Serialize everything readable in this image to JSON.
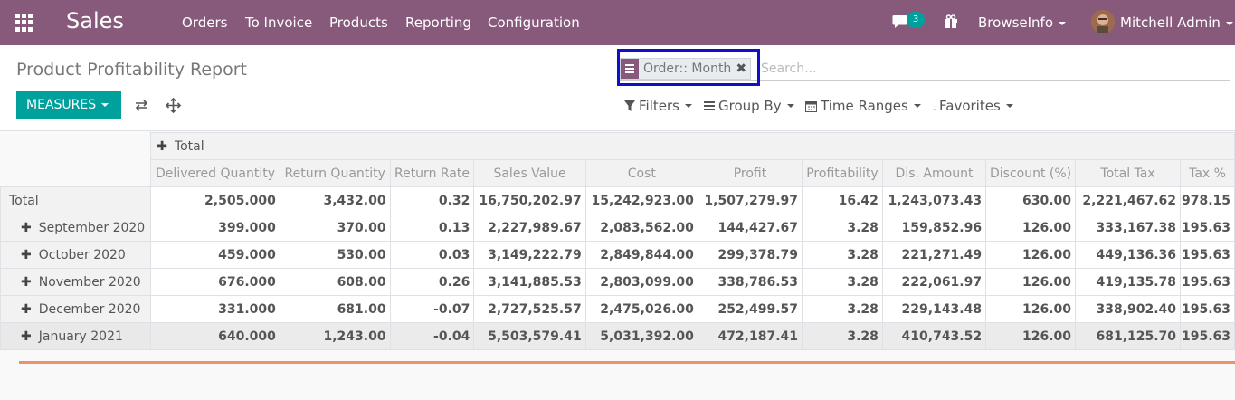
{
  "navbar": {
    "brand": "Sales",
    "menu": [
      "Orders",
      "To Invoice",
      "Products",
      "Reporting",
      "Configuration"
    ],
    "chat_count": "3",
    "browseinfo": "BrowseInfo",
    "user": "Mitchell Admin"
  },
  "control": {
    "title": "Product Profitability Report",
    "measures": "MEASURES",
    "facet": "Order:: Month",
    "search_placeholder": "Search...",
    "filters": "Filters",
    "group_by": "Group By",
    "time_ranges": "Time Ranges",
    "favorites": "Favorites"
  },
  "pivot": {
    "col_total": "Total",
    "headers": [
      "Delivered Quantity",
      "Return Quantity",
      "Return Rate",
      "Sales Value",
      "Cost",
      "Profit",
      "Profitability",
      "Dis. Amount",
      "Discount (%)",
      "Total Tax",
      "Tax %"
    ],
    "total_row": {
      "label": "Total",
      "values": [
        "2,505.000",
        "3,432.00",
        "0.32",
        "16,750,202.97",
        "15,242,923.00",
        "1,507,279.97",
        "16.42",
        "1,243,073.43",
        "630.00",
        "2,221,467.62",
        "978.15"
      ]
    },
    "rows": [
      {
        "label": "September 2020",
        "values": [
          "399.000",
          "370.00",
          "0.13",
          "2,227,989.67",
          "2,083,562.00",
          "144,427.67",
          "3.28",
          "159,852.96",
          "126.00",
          "333,167.38",
          "195.63"
        ]
      },
      {
        "label": "October 2020",
        "values": [
          "459.000",
          "530.00",
          "0.03",
          "3,149,222.79",
          "2,849,844.00",
          "299,378.79",
          "3.28",
          "221,271.49",
          "126.00",
          "449,136.36",
          "195.63"
        ]
      },
      {
        "label": "November 2020",
        "values": [
          "676.000",
          "608.00",
          "0.26",
          "3,141,885.53",
          "2,803,099.00",
          "338,786.53",
          "3.28",
          "222,061.97",
          "126.00",
          "419,135.78",
          "195.63"
        ]
      },
      {
        "label": "December 2020",
        "values": [
          "331.000",
          "681.00",
          "-0.07",
          "2,727,525.57",
          "2,475,026.00",
          "252,499.57",
          "3.28",
          "229,143.48",
          "126.00",
          "338,902.40",
          "195.63"
        ]
      },
      {
        "label": "January 2021",
        "values": [
          "640.000",
          "1,243.00",
          "-0.04",
          "5,503,579.41",
          "5,031,392.00",
          "472,187.41",
          "3.28",
          "410,743.52",
          "126.00",
          "681,125.70",
          "195.63"
        ]
      }
    ]
  },
  "colors": {
    "navbar": "#875a7b",
    "accent": "#00a09d",
    "highlight": "#1010c8",
    "orange_line": "#f0906b"
  }
}
